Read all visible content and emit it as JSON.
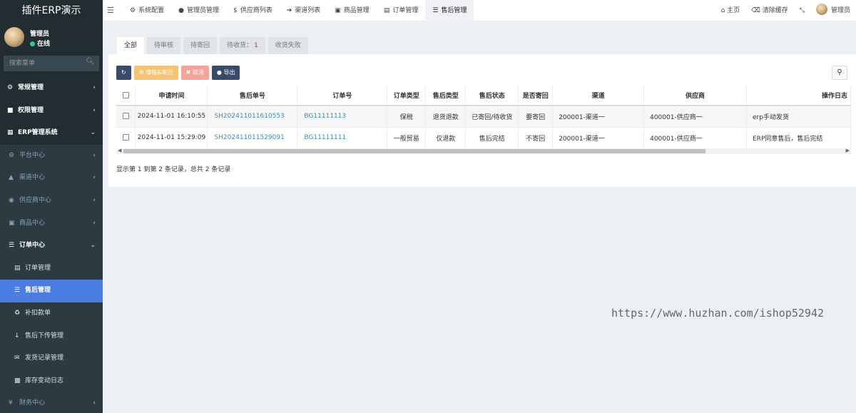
{
  "app": {
    "title": "插件ERP演示"
  },
  "user": {
    "name": "管理员",
    "status": "在线"
  },
  "sidebar": {
    "search_placeholder": "搜索菜单",
    "items": [
      {
        "label": "常规管理",
        "icon": "gears-icon"
      },
      {
        "label": "权限管理",
        "icon": "group-icon"
      },
      {
        "label": "ERP管理系统",
        "icon": "table-icon"
      },
      {
        "label": "平台中心",
        "icon": "gear-icon"
      },
      {
        "label": "渠道中心",
        "icon": "sitemap-icon"
      },
      {
        "label": "供应商中心",
        "icon": "dribbble-icon"
      },
      {
        "label": "商品中心",
        "icon": "briefcase-icon"
      },
      {
        "label": "订单中心",
        "icon": "list-icon"
      },
      {
        "label": "订单管理",
        "icon": "cart-icon"
      },
      {
        "label": "售后管理",
        "icon": "list-icon"
      },
      {
        "label": "补扣款单",
        "icon": "recycle-icon"
      },
      {
        "label": "售后下传管理",
        "icon": "arrow-down-icon"
      },
      {
        "label": "发货记录管理",
        "icon": "envelope-icon"
      },
      {
        "label": "库存变动日志",
        "icon": "bar-chart-icon"
      },
      {
        "label": "财务中心",
        "icon": "yen-icon"
      }
    ]
  },
  "topnav": {
    "tabs": [
      {
        "label": "系统配置",
        "icon": "gear-icon"
      },
      {
        "label": "管理员管理",
        "icon": "user-icon"
      },
      {
        "label": "供应商列表",
        "icon": "dollar-icon"
      },
      {
        "label": "渠道列表",
        "icon": "share-icon"
      },
      {
        "label": "商品管理",
        "icon": "briefcase-icon"
      },
      {
        "label": "订单管理",
        "icon": "cart-icon"
      },
      {
        "label": "售后管理",
        "icon": "list-icon"
      }
    ],
    "right": {
      "home": "主页",
      "clear_cache": "清除缓存",
      "user": "管理员"
    }
  },
  "status_tabs": {
    "all": "全部",
    "pending_review": "待审核",
    "pending_return": "待寄回",
    "pending_receipt": "待收货：",
    "pending_receipt_count": "1",
    "receipt_failed": "收货失败"
  },
  "toolbar": {
    "audit": "审核&寄回",
    "cancel": "取消",
    "export": "导出"
  },
  "table": {
    "headers": [
      "申请时间",
      "售后单号",
      "订单号",
      "订单类型",
      "售后类型",
      "售后状态",
      "是否寄回",
      "渠道",
      "供应商",
      "操作日志"
    ],
    "rows": [
      [
        "2024-11-01 16:10:55",
        "SH202411011610553",
        "BG11111113",
        "保税",
        "退货退款",
        "已寄回/待收货",
        "要寄回",
        "200001-渠道一",
        "400001-供应商一",
        "erp手动发货"
      ],
      [
        "2024-11-01 15:29:09",
        "SH202411011529091",
        "BG11111111",
        "一般贸易",
        "仅退款",
        "售后完结",
        "不寄回",
        "200001-渠道一",
        "400001-供应商一",
        "ERP同意售后，售后完结"
      ]
    ]
  },
  "pagination": {
    "info": "显示第 1 到第 2 条记录，总共 2 条记录"
  },
  "watermark": {
    "text": "https://www.huzhan.com/ishop52942"
  },
  "colors": {
    "sidebar_bg": "#222d32",
    "active": "#4a7de1",
    "link": "#3c8dbc"
  }
}
